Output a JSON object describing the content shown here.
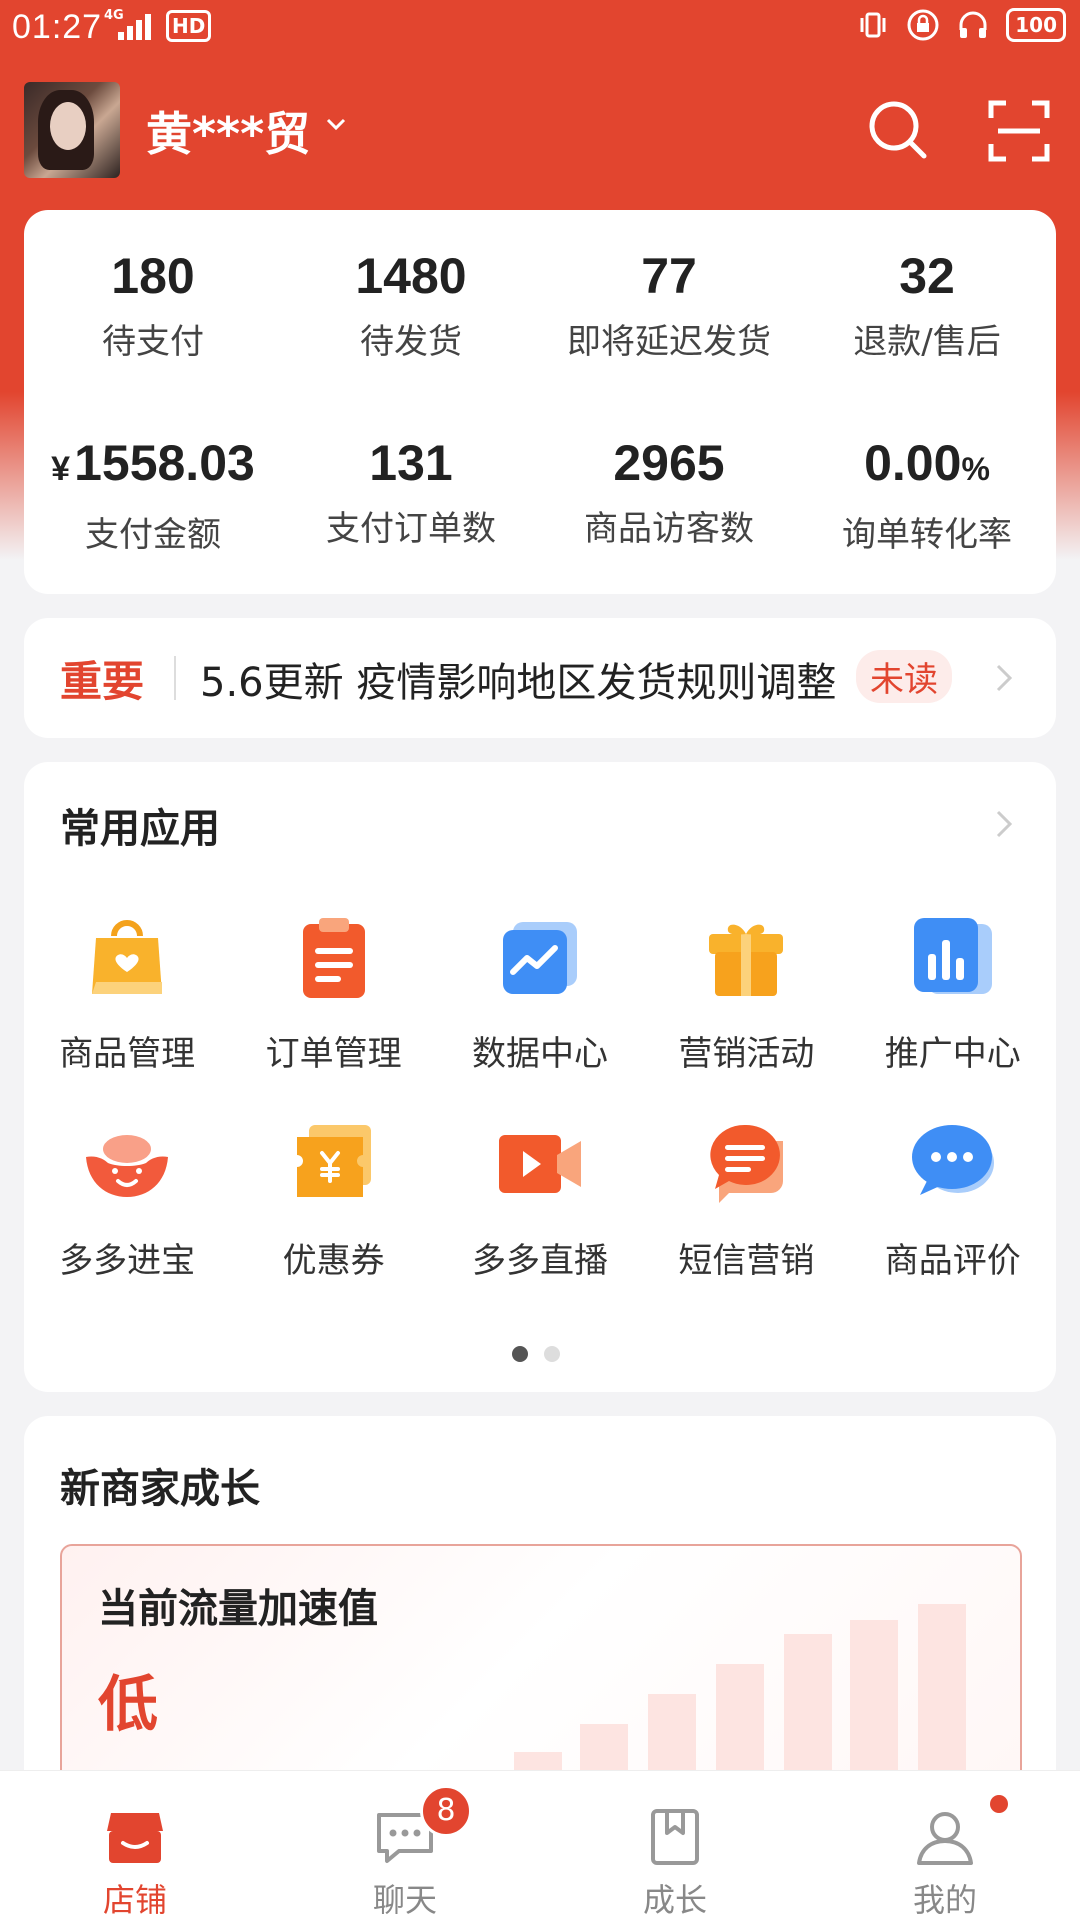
{
  "status_bar": {
    "time": "01:27",
    "signal": "4G",
    "hd": "HD",
    "battery": "100"
  },
  "header": {
    "shop_name": "黄***贸"
  },
  "stats": [
    {
      "value": "180",
      "label": "待支付"
    },
    {
      "value": "1480",
      "label": "待发货"
    },
    {
      "value": "77",
      "label": "即将延迟发货"
    },
    {
      "value": "32",
      "label": "退款/售后"
    },
    {
      "currency": "¥",
      "value": "1558.03",
      "label": "支付金额"
    },
    {
      "value": "131",
      "label": "支付订单数"
    },
    {
      "value": "2965",
      "label": "商品访客数"
    },
    {
      "value": "0.00",
      "unit": "%",
      "label": "询单转化率"
    }
  ],
  "notice": {
    "tag": "重要",
    "text": "5.6更新 疫情影响地区发货规则调整",
    "badge": "未读"
  },
  "apps": {
    "title": "常用应用",
    "items": [
      {
        "label": "商品管理",
        "icon": "shopping-bag-icon"
      },
      {
        "label": "订单管理",
        "icon": "clipboard-icon"
      },
      {
        "label": "数据中心",
        "icon": "chart-line-icon"
      },
      {
        "label": "营销活动",
        "icon": "gift-box-icon"
      },
      {
        "label": "推广中心",
        "icon": "bar-chart-icon"
      },
      {
        "label": "多多进宝",
        "icon": "gold-ingot-icon"
      },
      {
        "label": "优惠券",
        "icon": "coupon-icon"
      },
      {
        "label": "多多直播",
        "icon": "video-camera-icon"
      },
      {
        "label": "短信营销",
        "icon": "sms-bubble-icon"
      },
      {
        "label": "商品评价",
        "icon": "comment-bubble-icon"
      }
    ],
    "page_count": 2,
    "current_page": 1
  },
  "growth": {
    "title": "新商家成长",
    "flow_title": "当前流量加速值",
    "flow_value": "低"
  },
  "tabbar": {
    "items": [
      {
        "label": "店铺",
        "icon": "shop-icon",
        "active": true
      },
      {
        "label": "聊天",
        "icon": "chat-icon",
        "badge": "8"
      },
      {
        "label": "成长",
        "icon": "bookmark-book-icon"
      },
      {
        "label": "我的",
        "icon": "user-icon",
        "dot": true
      }
    ]
  },
  "colors": {
    "brand": "#e2452f",
    "background": "#f3f3f5"
  }
}
